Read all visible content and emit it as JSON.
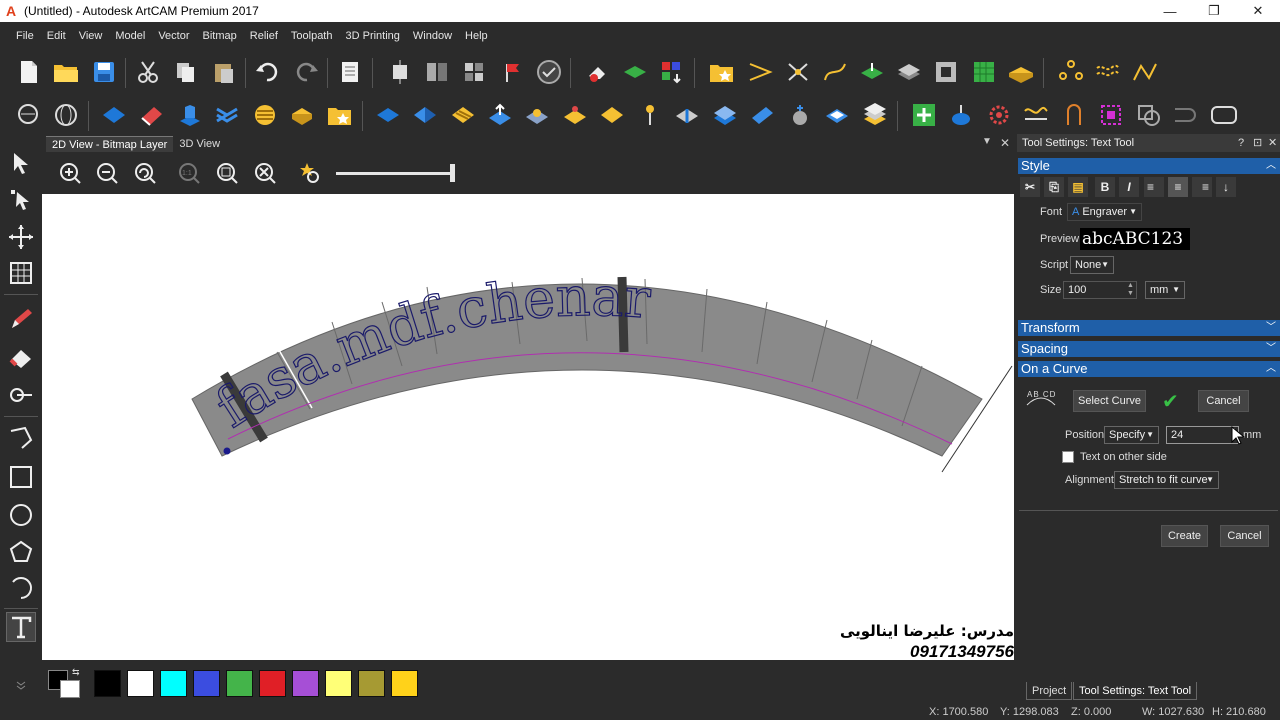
{
  "window": {
    "title": "(Untitled) - Autodesk ArtCAM Premium 2017",
    "app_icon": "A",
    "controls": [
      "—",
      "❐",
      "✕"
    ]
  },
  "menu": [
    "File",
    "Edit",
    "View",
    "Model",
    "Vector",
    "Bitmap",
    "Relief",
    "Toolpath",
    "3D Printing",
    "Window",
    "Help"
  ],
  "view_tabs": {
    "items": [
      "2D View - Bitmap Layer",
      "3D View"
    ],
    "active": 0
  },
  "canvas": {
    "curve_text": "fasa.mdf.chenar",
    "teacher_name": "مدرس: علیرضا اینالویی",
    "teacher_phone": "09171349756"
  },
  "swatches": [
    "#000000",
    "#ffffff",
    "#00ffff",
    "#3b4de0",
    "#44b44a",
    "#e01f26",
    "#a64fd6",
    "#ffff77",
    "#a69a33",
    "#ffd21a"
  ],
  "panel": {
    "title": "Tool Settings: Text Tool",
    "title_controls": [
      "?",
      "⊡",
      "✕"
    ],
    "sections": {
      "style": "Style",
      "transform": "Transform",
      "spacing": "Spacing",
      "on_curve": "On a Curve"
    },
    "style_icons": [
      "✂",
      "⎘",
      "▤",
      "B",
      "I",
      "≡",
      "≡",
      "≡",
      "↓"
    ],
    "font_label": "Font",
    "font_value": "Engraver",
    "preview_label": "Preview",
    "preview_text": "abcABC123",
    "script_label": "Script",
    "script_value": "None",
    "size_label": "Size",
    "size_value": "100",
    "size_unit": "mm",
    "curve_icon_text": "AB CD",
    "select_curve": "Select Curve",
    "cancel": "Cancel",
    "position_label": "Position",
    "position_mode": "Specify",
    "position_value": "24",
    "position_unit": "mm",
    "other_side": "Text on other side",
    "alignment_label": "Alignment",
    "alignment_value": "Stretch to fit curve",
    "create": "Create",
    "cancel2": "Cancel"
  },
  "bottom_tabs": [
    "Project",
    "Tool Settings: Text Tool"
  ],
  "status": {
    "x": "X: 1700.580",
    "y": "Y: 1298.083",
    "z": "Z: 0.000",
    "w": "W: 1027.630",
    "h": "H: 210.680"
  }
}
